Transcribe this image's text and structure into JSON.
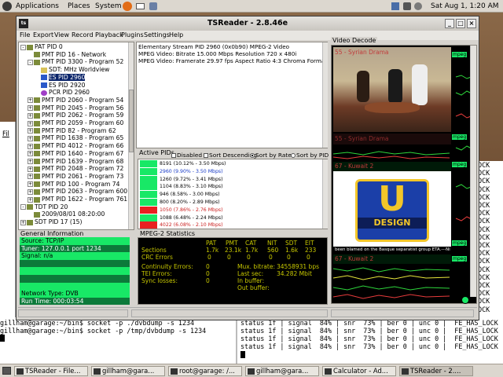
{
  "topbar": {
    "applications": "Applications",
    "places": "Places",
    "system": "System",
    "clock": "Sat Aug 1,  1:20 AM"
  },
  "window": {
    "title": "TSReader - 2.8.46e",
    "menus": [
      "File",
      "Export",
      "View",
      "Record",
      "Playback",
      "Plugins",
      "Settings",
      "Help"
    ]
  },
  "tree": [
    {
      "label": "PAT PID 0",
      "indent": 0,
      "exp": "-",
      "icon": "pat"
    },
    {
      "label": "PMT PID 16 - Network",
      "indent": 1,
      "exp": "",
      "icon": "pmt"
    },
    {
      "label": "PMT PID 3300 - Program 52",
      "indent": 1,
      "exp": "-",
      "icon": "pmt"
    },
    {
      "label": "SDT: MHz Worldview",
      "indent": 2,
      "exp": "",
      "icon": "sdt"
    },
    {
      "label": "ES PID 2960",
      "indent": 2,
      "exp": "",
      "icon": "es",
      "sel": true
    },
    {
      "label": "ES PID 2920",
      "indent": 2,
      "exp": "",
      "icon": "es"
    },
    {
      "label": "PCR PID 2960",
      "indent": 2,
      "exp": "",
      "icon": "pcr"
    },
    {
      "label": "PMT PID 2060 - Program 54",
      "indent": 1,
      "exp": "+",
      "icon": "pmt"
    },
    {
      "label": "PMT PID 2045 - Program 56",
      "indent": 1,
      "exp": "+",
      "icon": "pmt"
    },
    {
      "label": "PMT PID 2062 - Program 59",
      "indent": 1,
      "exp": "+",
      "icon": "pmt"
    },
    {
      "label": "PMT PID 2059 - Program 60",
      "indent": 1,
      "exp": "+",
      "icon": "pmt"
    },
    {
      "label": "PMT PID 82 - Program 62",
      "indent": 1,
      "exp": "+",
      "icon": "pmt"
    },
    {
      "label": "PMT PID 1638 - Program 65",
      "indent": 1,
      "exp": "+",
      "icon": "pmt"
    },
    {
      "label": "PMT PID 4012 - Program 66",
      "indent": 1,
      "exp": "+",
      "icon": "pmt"
    },
    {
      "label": "PMT PID 1640 - Program 67",
      "indent": 1,
      "exp": "+",
      "icon": "pmt"
    },
    {
      "label": "PMT PID 1639 - Program 68",
      "indent": 1,
      "exp": "+",
      "icon": "pmt"
    },
    {
      "label": "PMT PID 2048 - Program 72",
      "indent": 1,
      "exp": "+",
      "icon": "pmt"
    },
    {
      "label": "PMT PID 2061 - Program 73",
      "indent": 1,
      "exp": "+",
      "icon": "pmt"
    },
    {
      "label": "PMT PID 100 - Program 74",
      "indent": 1,
      "exp": "+",
      "icon": "pmt"
    },
    {
      "label": "PMT PID 2063 - Program 600",
      "indent": 1,
      "exp": "+",
      "icon": "pmt"
    },
    {
      "label": "PMT PID 1622 - Program 761",
      "indent": 1,
      "exp": "+",
      "icon": "pmt"
    },
    {
      "label": "TDT PID 20",
      "indent": 0,
      "exp": "-",
      "icon": "pat"
    },
    {
      "label": "2009/08/01 08:20:00",
      "indent": 1,
      "exp": "",
      "icon": "pmt"
    },
    {
      "label": "SDT PID 17 (15)",
      "indent": 0,
      "exp": "+",
      "icon": "pat"
    }
  ],
  "es_info": [
    "Elementary Stream PID 2960 (0x0b90) MPEG-2 Video",
    "MPEG Video: Bitrate 15.000 Mbps Resolution 720 x 480i",
    "MPEG Video: Framerate 29.97 fps Aspect Ratio 4:3 Chroma Format 4:2:0"
  ],
  "general_info": {
    "title": "General Information",
    "rows": [
      "Source: TCP/IP",
      "Tuner: 127.0.0.1 port 1234",
      "Signal: n/a",
      "",
      "",
      "",
      "",
      "Network Type: DVB",
      "Run Time: 000:03:54"
    ]
  },
  "active_pids": {
    "title": "Active PIDs",
    "disabled": "Disabled",
    "sort_desc": "Sort Descending",
    "sort_rate": "Sort by Rate",
    "sort_pid": "Sort by PID",
    "rows": [
      {
        "text": "8191 (10.12% - 3.50 Mbps)",
        "color": "#18e866",
        "tcolor": "#000"
      },
      {
        "text": "2960 (9.90% - 3.50 Mbps)",
        "color": "#18e866",
        "tcolor": "#1a3cc7"
      },
      {
        "text": "1260 (9.72% - 3.41 Mbps)",
        "color": "#18e866",
        "tcolor": "#000"
      },
      {
        "text": "1104 (8.83% - 3.10 Mbps)",
        "color": "#18e866",
        "tcolor": "#000"
      },
      {
        "text": "946 (8.58% - 3.00 Mbps)",
        "color": "#18e866",
        "tcolor": "#000"
      },
      {
        "text": "800 (8.20% - 2.89 Mbps)",
        "color": "#18e866",
        "tcolor": "#000"
      },
      {
        "text": "1050 (7.86% - 2.76 Mbps)",
        "color": "#e82020",
        "tcolor": "#c22"
      },
      {
        "text": "1088 (6.48% - 2.24 Mbps)",
        "color": "#18e866",
        "tcolor": "#000"
      },
      {
        "text": "4022 (6.08% - 2.10 Mbps)",
        "color": "#e82020",
        "tcolor": "#c22"
      }
    ]
  },
  "mpeg_stats": {
    "title": "MPEG-2 Statistics",
    "headers": [
      "PAT",
      "PMT",
      "CAT",
      "NIT",
      "SDT",
      "EIT"
    ],
    "sections_label": "Sections",
    "sections": [
      "1.7k",
      "23.1k",
      "1.7k",
      "560",
      "1.6k",
      "233"
    ],
    "crc_label": "CRC Errors",
    "crc": [
      "0",
      "0",
      "0",
      "0",
      "0",
      "0"
    ],
    "cont_label": "Continuity Errors:",
    "cont": "0",
    "mux_label": "Mux. bitrate:",
    "mux": "34558931 bps",
    "tei_label": "TEI Errors:",
    "tei": "0",
    "last_label": "Last sec:",
    "last": "34.282 Mbit",
    "sync_label": "Sync losses:",
    "sync": "0",
    "inbuf_label": "In buffer:",
    "outbuf_label": "Out buffer:"
  },
  "video_decode": {
    "title": "Video Decode",
    "tiles": [
      {
        "label": "55 - Syrian Drama",
        "mpeg": "mpeg"
      },
      {
        "label": "55 - Syrian Drama",
        "mpeg": "mpeg"
      },
      {
        "label": "67 - Kuwait 2",
        "mpeg": "mpeg"
      },
      {
        "label": "67 - Kuwait 2",
        "mpeg": "mpeg"
      }
    ],
    "caption": "been blamed on the Basque separatist group ETA.---Ni",
    "logo_top": "U",
    "logo_text": "DESIGN"
  },
  "terminal": {
    "lines": [
      "gillham@garage:~/bin$ socket -p ./dvbdump -s 1234",
      "gillham@garage:~/bin$ socket -p /tmp/dvbdump -s 1234"
    ],
    "status": [
      "status 1f | signal  84% | snr  73% | ber 0 | unc 0 |  FE_HAS_LOCK",
      "status 1f | signal  84% | snr  73% | ber 0 | unc 0 |  FE_HAS_LOCK",
      "status 1f | signal  84% | snr  73% | ber 0 | unc 0 |  FE_HAS_LOCK",
      "status 1f | signal  84% | snr  73% | ber 0 | unc 0 |  FE_HAS_LOCK"
    ],
    "right": [
      "LOCK",
      "LOCK",
      "LOCK",
      "LOCK",
      "LOCK",
      "LOCK",
      "LOCK",
      "LOCK",
      "LOCK",
      "LOCK",
      "LOCK",
      "LOCK",
      "LOCK",
      "LOCK",
      "LOCK",
      "LOCK",
      "LOCK",
      "LOCK",
      "LOCK"
    ],
    "left_label": "Fil"
  },
  "taskbar": [
    {
      "label": "TSReader - File..."
    },
    {
      "label": "gillham@gara..."
    },
    {
      "label": "root@garage: /..."
    },
    {
      "label": "gillham@gara..."
    },
    {
      "label": "Calculator - Ad..."
    },
    {
      "label": "TSReader - 2....",
      "active": true
    }
  ]
}
